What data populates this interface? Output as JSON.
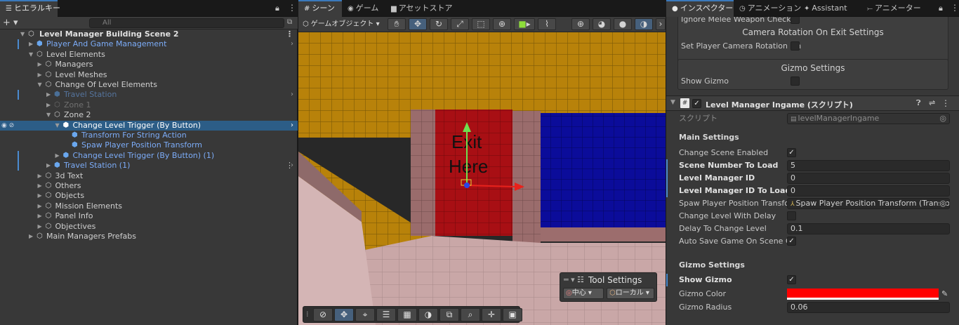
{
  "hierarchy": {
    "tab_label": "ヒエラルキー",
    "add_label": "+ ▾",
    "search_placeholder": "All",
    "scene_name": "Level Manager Building Scene 2",
    "items": [
      {
        "label": "Player And Game Management",
        "depth": 1,
        "arrow": "▶",
        "prefab": true
      },
      {
        "label": "Level Elements",
        "depth": 1,
        "arrow": "▼"
      },
      {
        "label": "Managers",
        "depth": 2,
        "arrow": "▶"
      },
      {
        "label": "Level Meshes",
        "depth": 2,
        "arrow": "▶"
      },
      {
        "label": "Change Of Level Elements",
        "depth": 2,
        "arrow": "▼"
      },
      {
        "label": "Travel Station",
        "depth": 3,
        "arrow": "▶",
        "prefab": true,
        "inactive": true
      },
      {
        "label": "Zone 1",
        "depth": 3,
        "arrow": "▶",
        "inactive": true
      },
      {
        "label": "Zone 2",
        "depth": 3,
        "arrow": "▼"
      },
      {
        "label": "Change Level Trigger (By Button)",
        "depth": 4,
        "arrow": "▼",
        "prefab": true,
        "selected": true
      },
      {
        "label": "Transform For String Action",
        "depth": 5,
        "prefab": true
      },
      {
        "label": "Spaw Player Position Transform",
        "depth": 5,
        "prefab": true
      },
      {
        "label": "Change Level Trigger (By Button) (1)",
        "depth": 4,
        "arrow": "▶",
        "prefab": true
      },
      {
        "label": "Travel Station (1)",
        "depth": 3,
        "arrow": "▶",
        "prefab": true
      },
      {
        "label": "3d Text",
        "depth": 2,
        "arrow": "▶"
      },
      {
        "label": "Others",
        "depth": 2,
        "arrow": "▶"
      },
      {
        "label": "Objects",
        "depth": 2,
        "arrow": "▶"
      },
      {
        "label": "Mission Elements",
        "depth": 2,
        "arrow": "▶"
      },
      {
        "label": "Panel Info",
        "depth": 2,
        "arrow": "▶"
      },
      {
        "label": "Objectives",
        "depth": 2,
        "arrow": "▶"
      },
      {
        "label": "Main Managers Prefabs",
        "depth": 1,
        "arrow": "▶"
      }
    ]
  },
  "scene": {
    "tabs": [
      "シーン",
      "ゲーム",
      "アセットストア"
    ],
    "gameobject_dropdown": "ゲームオブジェクト ▾",
    "door_text_line1": "Exit",
    "door_text_line2": "Here",
    "tool_settings": {
      "title": "Tool Settings",
      "pivot_label": "中心 ▾",
      "space_label": "ローカル ▾"
    }
  },
  "inspector": {
    "tabs": [
      "インスペクター",
      "アニメーション",
      "Assistant",
      "アニメーター"
    ],
    "top_partial_label": "Ignore Melee Weapon Check",
    "camera_section_title": "Camera Rotation On Exit Settings",
    "set_camera_label": "Set Player Camera Rotation On",
    "gizmo_section_title": "Gizmo Settings",
    "show_gizmo_label_1": "Show Gizmo",
    "component_title": "Level Manager Ingame (スクリプト)",
    "script_label": "スクリプト",
    "script_value": "levelManagerIngame",
    "main_settings": "Main Settings",
    "change_scene_enabled": "Change Scene Enabled",
    "scene_number_label": "Scene Number To Load",
    "scene_number_value": "5",
    "level_manager_id_label": "Level Manager ID",
    "level_manager_id_value": "0",
    "level_manager_id_to_load_label": "Level Manager ID To Load",
    "level_manager_id_to_load_value": "0",
    "spaw_player_label": "Spaw Player Position Transfor",
    "spaw_player_value": "Spaw Player Position Transform (Transfo",
    "change_with_delay_label": "Change Level With Delay",
    "delay_label": "Delay To Change Level",
    "delay_value": "0.1",
    "autosave_label": "Auto Save Game On Scene Ch",
    "gizmo_settings": "Gizmo Settings",
    "show_gizmo_label_2": "Show Gizmo",
    "gizmo_color_label": "Gizmo Color",
    "gizmo_color": "#ff0000",
    "gizmo_radius_label": "Gizmo Radius",
    "gizmo_radius_value": "0.06"
  },
  "colors": {
    "selection": "#2c5d87",
    "prefab_blue": "#7cacf8",
    "accent": "#3a79bb"
  }
}
